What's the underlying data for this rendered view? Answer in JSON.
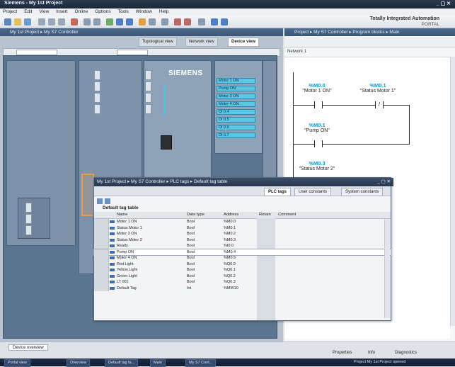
{
  "window": {
    "title": "Siemens - My 1st Project"
  },
  "menu": [
    "Project",
    "Edit",
    "View",
    "Insert",
    "Online",
    "Options",
    "Tools",
    "Window",
    "Help"
  ],
  "brand": {
    "line1": "Totally Integrated Automation",
    "line2": "PORTAL"
  },
  "left_panel": {
    "header": "My 1st Project ▸ My S7 Controller",
    "views": [
      "Topological view",
      "Network view",
      "Device view"
    ],
    "cpu_label": "SIEMENS",
    "io_labels": [
      "Motor 1 ON",
      "Pump ON",
      "Motor 3 ON",
      "Motor 4 ON",
      "DI 0.4",
      "DI 0.5",
      "DI 0.6",
      "DI 0.7"
    ],
    "bottom_tab": "Device overview"
  },
  "right_panel": {
    "header": "Project ▸ My S7 Controller ▸ Program blocks ▸ Main",
    "network_label": "Network 1",
    "contacts": [
      {
        "address": "%M0.0",
        "name": "\"Motor 1 ON\""
      },
      {
        "address": "%M0.1",
        "name": "\"Status Motor 1\""
      },
      {
        "address": "%M0.1",
        "name": "\"Pump ON\""
      },
      {
        "address": "%M0.3",
        "name": "\"Status Motor 2\""
      }
    ]
  },
  "dialog": {
    "title": "My 1st Project ▸ My S7 Controller ▸ PLC tags ▸ Default tag table",
    "tabs": [
      "PLC tags",
      "User constants",
      "System constants"
    ],
    "table_title": "Default tag table",
    "columns": [
      "Name",
      "Data type",
      "Address",
      "Retain",
      "Comment"
    ],
    "rows": [
      {
        "name": "Motor 1 ON",
        "type": "Bool",
        "addr": "%M0.0"
      },
      {
        "name": "Status Motor 1",
        "type": "Bool",
        "addr": "%M0.1"
      },
      {
        "name": "Motor 3 ON",
        "type": "Bool",
        "addr": "%M0.2"
      },
      {
        "name": "Status Motor 2",
        "type": "Bool",
        "addr": "%M0.3"
      },
      {
        "name": "Ready",
        "type": "Bool",
        "addr": "%I0.0"
      },
      {
        "name": "Pump ON",
        "type": "Bool",
        "addr": "%M0.4"
      },
      {
        "name": "Motor 4 ON",
        "type": "Bool",
        "addr": "%M0.5"
      },
      {
        "name": "Red Light",
        "type": "Bool",
        "addr": "%Q0.0"
      },
      {
        "name": "Yellow Light",
        "type": "Bool",
        "addr": "%Q0.1"
      },
      {
        "name": "Green Light",
        "type": "Bool",
        "addr": "%Q0.2"
      },
      {
        "name": "LT 001",
        "type": "Bool",
        "addr": "%Q0.3"
      },
      {
        "name": "Default Tag",
        "type": "Int",
        "addr": "%MW10"
      }
    ]
  },
  "status": {
    "right_tabs": [
      "Properties",
      "Info",
      "Diagnostics"
    ]
  },
  "taskbar": [
    "Portal view",
    "Overview",
    "Default tag ta...",
    "Main",
    "My S7 Cont...",
    "Project My 1st Project opened"
  ]
}
